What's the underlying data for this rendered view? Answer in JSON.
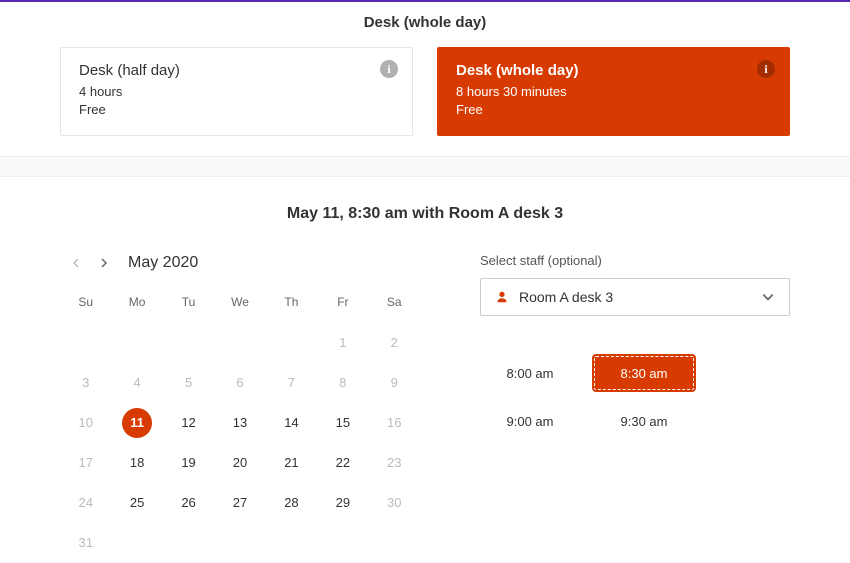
{
  "pageTitle": "Desk (whole day)",
  "options": {
    "half": {
      "title": "Desk (half day)",
      "duration": "4 hours",
      "price": "Free"
    },
    "whole": {
      "title": "Desk (whole day)",
      "duration": "8 hours 30 minutes",
      "price": "Free"
    }
  },
  "summary": "May 11, 8:30 am with Room A desk 3",
  "calendar": {
    "month": "May 2020",
    "dow": [
      "Su",
      "Mo",
      "Tu",
      "We",
      "Th",
      "Fr",
      "Sa"
    ],
    "rows": [
      [
        null,
        null,
        null,
        null,
        null,
        {
          "d": "1",
          "m": true
        },
        {
          "d": "2",
          "m": true
        }
      ],
      [
        {
          "d": "3",
          "m": true
        },
        {
          "d": "4",
          "m": true
        },
        {
          "d": "5",
          "m": true
        },
        {
          "d": "6",
          "m": true
        },
        {
          "d": "7",
          "m": true
        },
        {
          "d": "8",
          "m": true
        },
        {
          "d": "9",
          "m": true
        }
      ],
      [
        {
          "d": "10",
          "m": true
        },
        {
          "d": "11",
          "sel": true
        },
        {
          "d": "12"
        },
        {
          "d": "13"
        },
        {
          "d": "14"
        },
        {
          "d": "15"
        },
        {
          "d": "16",
          "m": true
        }
      ],
      [
        {
          "d": "17",
          "m": true
        },
        {
          "d": "18"
        },
        {
          "d": "19"
        },
        {
          "d": "20"
        },
        {
          "d": "21"
        },
        {
          "d": "22"
        },
        {
          "d": "23",
          "m": true
        }
      ],
      [
        {
          "d": "24",
          "m": true
        },
        {
          "d": "25"
        },
        {
          "d": "26"
        },
        {
          "d": "27"
        },
        {
          "d": "28"
        },
        {
          "d": "29"
        },
        {
          "d": "30",
          "m": true
        }
      ],
      [
        {
          "d": "31",
          "m": true
        },
        null,
        null,
        null,
        null,
        null,
        null
      ]
    ]
  },
  "staff": {
    "label": "Select staff (optional)",
    "value": "Room A desk 3"
  },
  "slots": [
    {
      "t": "8:00 am"
    },
    {
      "t": "8:30 am",
      "sel": true
    },
    {
      "t": "9:00 am"
    },
    {
      "t": "9:30 am"
    }
  ]
}
